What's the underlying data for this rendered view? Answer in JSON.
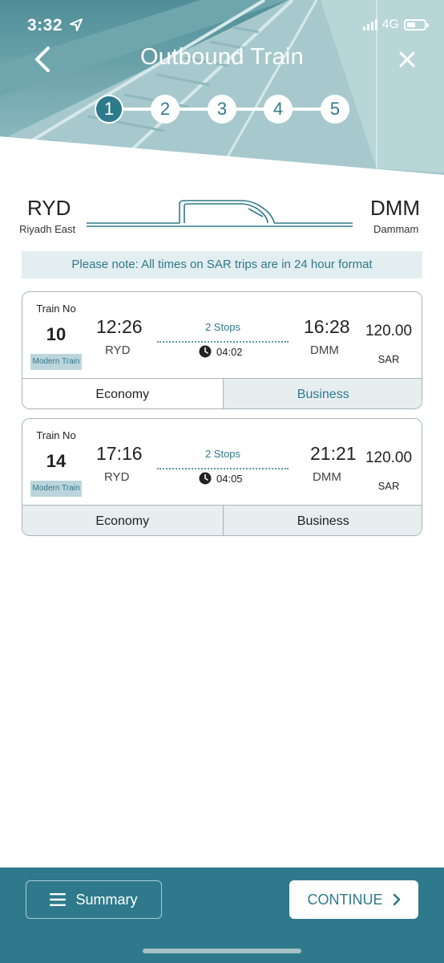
{
  "status_bar": {
    "time": "3:32",
    "network": "4G"
  },
  "header": {
    "title": "Outbound Train",
    "steps": [
      "1",
      "2",
      "3",
      "4",
      "5"
    ],
    "active_step": 1
  },
  "route": {
    "from_code": "RYD",
    "from_city": "Riyadh East",
    "to_code": "DMM",
    "to_city": "Dammam"
  },
  "note": "Please note: All times on SAR trips are in 24 hour format",
  "trains": [
    {
      "label": "Train No",
      "number": "10",
      "type": "Modern Train",
      "dep_time": "12:26",
      "dep_station": "RYD",
      "stops": "2 Stops",
      "duration": "04:02",
      "arr_time": "16:28",
      "arr_station": "DMM",
      "price": "120.00",
      "currency": "SAR",
      "economy": "Economy",
      "business": "Business"
    },
    {
      "label": "Train No",
      "number": "14",
      "type": "Modern Train",
      "dep_time": "17:16",
      "dep_station": "RYD",
      "stops": "2 Stops",
      "duration": "04:05",
      "arr_time": "21:21",
      "arr_station": "DMM",
      "price": "120.00",
      "currency": "SAR",
      "economy": "Economy",
      "business": "Business"
    }
  ],
  "footer": {
    "summary": "Summary",
    "continue": "CONTINUE"
  },
  "colors": {
    "accent": "#2e7a8c",
    "note_bg": "#e3eef0",
    "tag_bg": "#bcd4dc"
  }
}
